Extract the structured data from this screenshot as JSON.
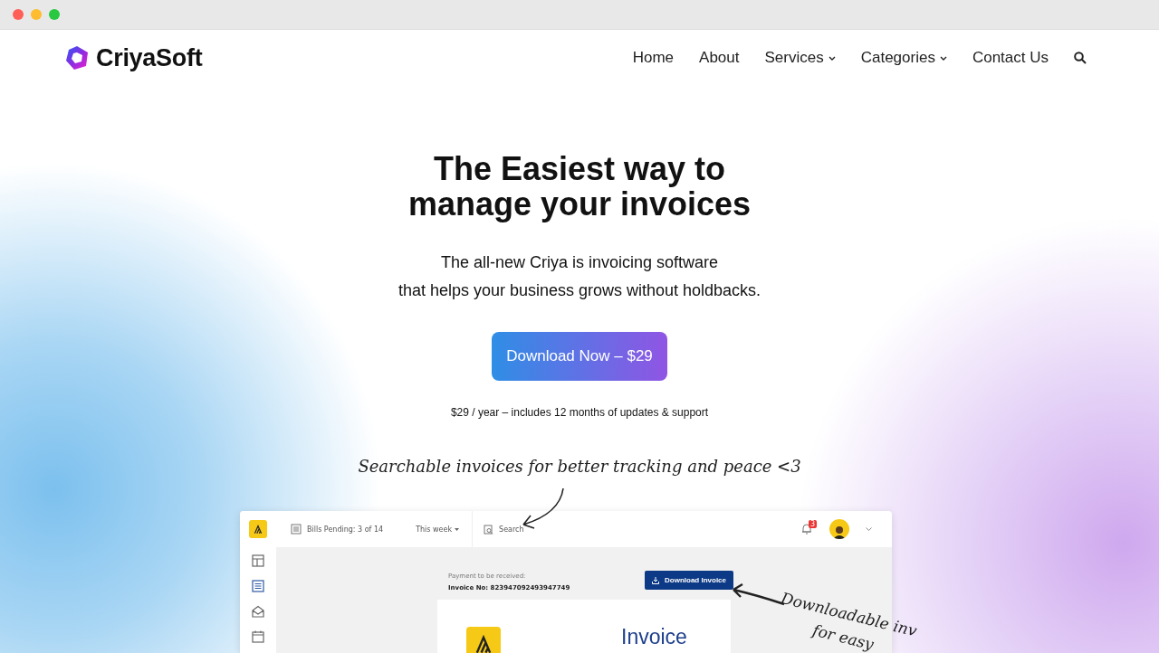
{
  "nav": {
    "brand": "CriyaSoft",
    "items": [
      {
        "label": "Home",
        "dropdown": false
      },
      {
        "label": "About",
        "dropdown": false
      },
      {
        "label": "Services",
        "dropdown": true
      },
      {
        "label": "Categories",
        "dropdown": true
      },
      {
        "label": "Contact Us",
        "dropdown": false
      }
    ]
  },
  "hero": {
    "title": [
      "The Easiest way to",
      "manage your invoices"
    ],
    "subtitle": [
      "The all-new Criya is invoicing software",
      "that helps your business grows without holdbacks."
    ],
    "cta": "Download Now – $29",
    "note": "$29 / year – includes 12 months of updates & support"
  },
  "annotations": [
    {
      "kind": "search",
      "lines": [
        "Searchable invoices for better tracking and peace <3"
      ]
    },
    {
      "kind": "download",
      "lines": [
        "Downloadable inv",
        "for easy"
      ]
    }
  ],
  "mockup": {
    "bills_pending": "Bills Pending: 3 of 14",
    "period": "This week",
    "search_placeholder": "Search",
    "notification_count": "3",
    "sidebar": [
      {
        "kind": "dashboard",
        "selected": false
      },
      {
        "kind": "list",
        "selected": true
      },
      {
        "kind": "mail",
        "selected": false
      },
      {
        "kind": "calendar",
        "selected": false
      }
    ],
    "payment_label": "Payment to be received:",
    "invoice_no": "Invoice No: 823947092493947749",
    "download_button": "Download Invoice",
    "invoice_title": "Invoice"
  }
}
